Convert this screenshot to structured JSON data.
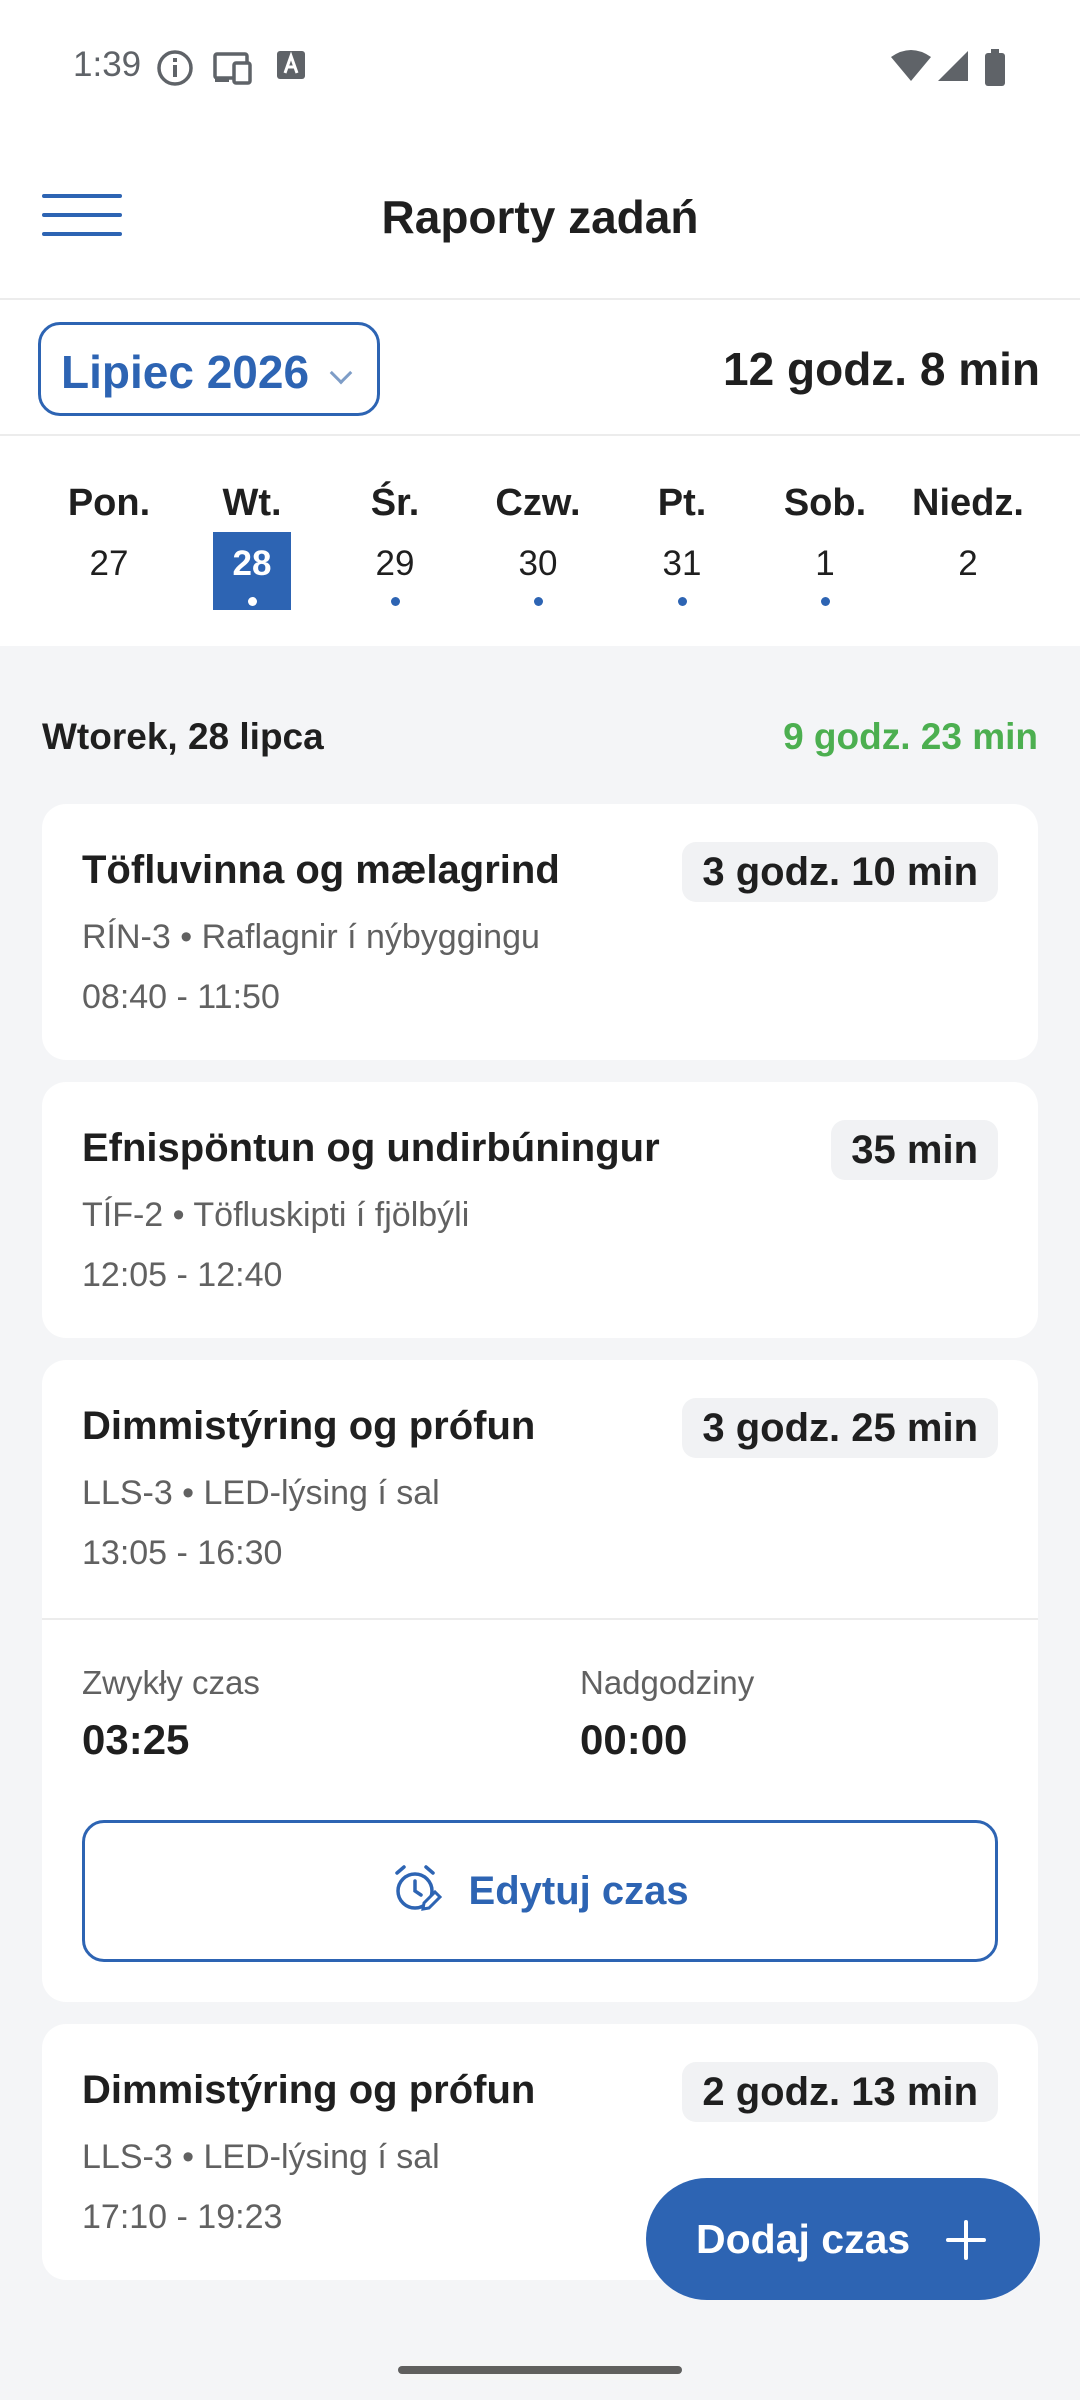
{
  "status_bar": {
    "time": "1:39",
    "icons": [
      "info-icon",
      "cast-icon",
      "keyboard-a-icon",
      "wifi-icon",
      "signal-icon",
      "battery-icon"
    ]
  },
  "app_bar": {
    "title": "Raporty zadań",
    "menu_icon": "hamburger-menu-icon"
  },
  "month_bar": {
    "month_label": "Lipiec 2026",
    "month_total": "12 godz. 8 min"
  },
  "week": {
    "days": [
      {
        "name": "Pon.",
        "num": "27",
        "has_entries": false,
        "selected": false
      },
      {
        "name": "Wt.",
        "num": "28",
        "has_entries": true,
        "selected": true
      },
      {
        "name": "Śr.",
        "num": "29",
        "has_entries": true,
        "selected": false
      },
      {
        "name": "Czw.",
        "num": "30",
        "has_entries": true,
        "selected": false
      },
      {
        "name": "Pt.",
        "num": "31",
        "has_entries": true,
        "selected": false
      },
      {
        "name": "Sob.",
        "num": "1",
        "has_entries": true,
        "selected": false
      },
      {
        "name": "Niedz.",
        "num": "2",
        "has_entries": false,
        "selected": false
      }
    ]
  },
  "day": {
    "heading": "Wtorek, 28 lipca",
    "total": "9 godz. 23 min"
  },
  "entries": [
    {
      "title": "Töfluvinna og mælagrind",
      "duration": "3 godz. 10 min",
      "subtitle": "RÍN-3 • Raflagnir í nýbyggingu",
      "time_range": "08:40 - 11:50"
    },
    {
      "title": "Efnispöntun og undirbúningur",
      "duration": "35 min",
      "subtitle": "TÍF-2 • Töfluskipti í fjölbýli",
      "time_range": "12:05 - 12:40"
    },
    {
      "title": "Dimmistýring og prófun",
      "duration": "3 godz. 25 min",
      "subtitle": "LLS-3 • LED-lýsing í sal",
      "time_range": "13:05 - 16:30",
      "regular_label": "Zwykły czas",
      "regular_value": "03:25",
      "overtime_label": "Nadgodziny",
      "overtime_value": "00:00",
      "edit_label": "Edytuj czas"
    },
    {
      "title": "Dimmistýring og prófun",
      "duration": "2 godz. 13 min",
      "subtitle": "LLS-3 • LED-lýsing í sal",
      "time_range": "17:10 - 19:23"
    }
  ],
  "fab": {
    "label": "Dodaj czas"
  },
  "colors": {
    "accent": "#2d64b3",
    "positive": "#4caf50",
    "background": "#f4f5f7"
  }
}
